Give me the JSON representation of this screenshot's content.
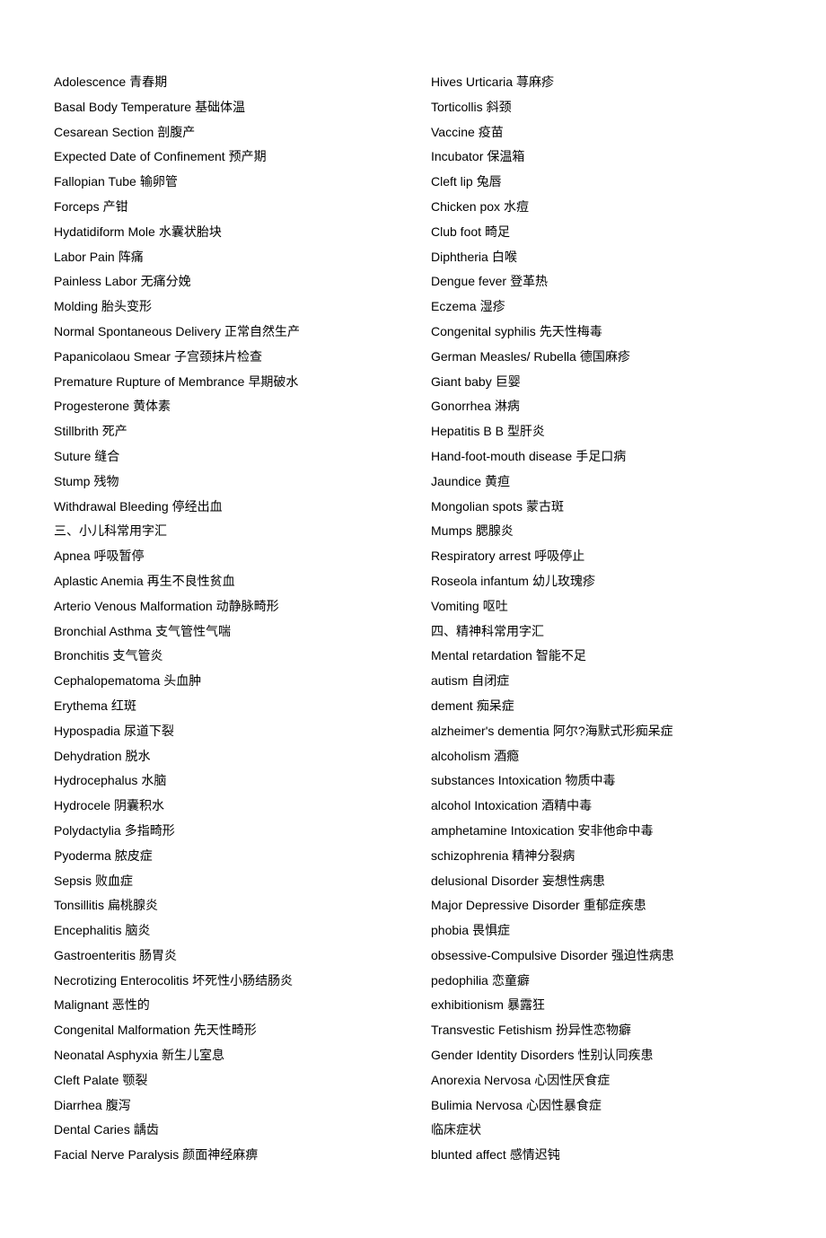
{
  "left_column": [
    {
      "en": "Adolescence",
      "zh": "青春期"
    },
    {
      "en": "Basal Body Temperature",
      "zh": "基础体温"
    },
    {
      "en": "Cesarean Section",
      "zh": "剖腹产"
    },
    {
      "en": "Expected Date of Confinement",
      "zh": "预产期"
    },
    {
      "en": "Fallopian Tube",
      "zh": "输卵管"
    },
    {
      "en": "Forceps",
      "zh": "产钳"
    },
    {
      "en": "Hydatidiform Mole",
      "zh": "水囊状胎块"
    },
    {
      "en": "Labor Pain",
      "zh": "阵痛"
    },
    {
      "en": "Painless Labor",
      "zh": "无痛分娩"
    },
    {
      "en": "Molding",
      "zh": "胎头变形"
    },
    {
      "en": "Normal Spontaneous Delivery",
      "zh": "正常自然生产"
    },
    {
      "en": "Papanicolaou Smear",
      "zh": "子宫颈抹片检查"
    },
    {
      "en": "Premature Rupture of Membrance",
      "zh": "早期破水"
    },
    {
      "en": "Progesterone",
      "zh": "黄体素"
    },
    {
      "en": "Stillbrith",
      "zh": "死产"
    },
    {
      "en": "Suture",
      "zh": "缝合"
    },
    {
      "en": "Stump",
      "zh": "残物"
    },
    {
      "en": "Withdrawal Bleeding",
      "zh": "停经出血"
    },
    {
      "en": "三、小儿科常用字汇",
      "zh": ""
    },
    {
      "en": "Apnea",
      "zh": "呼吸暂停"
    },
    {
      "en": "Aplastic Anemia",
      "zh": "再生不良性贫血"
    },
    {
      "en": "Arterio Venous Malformation",
      "zh": "动静脉畸形"
    },
    {
      "en": "Bronchial Asthma",
      "zh": "支气管性气喘"
    },
    {
      "en": "Bronchitis",
      "zh": "支气管炎"
    },
    {
      "en": "Cephalopematoma",
      "zh": "头血肿"
    },
    {
      "en": "Erythema",
      "zh": "红斑"
    },
    {
      "en": "Hypospadia",
      "zh": "尿道下裂"
    },
    {
      "en": "Dehydration",
      "zh": "脱水"
    },
    {
      "en": "Hydrocephalus",
      "zh": "水脑"
    },
    {
      "en": "Hydrocele",
      "zh": "阴囊积水"
    },
    {
      "en": "Polydactylia",
      "zh": "多指畸形"
    },
    {
      "en": "Pyoderma",
      "zh": "脓皮症"
    },
    {
      "en": "Sepsis",
      "zh": "败血症"
    },
    {
      "en": "Tonsillitis",
      "zh": "扁桃腺炎"
    },
    {
      "en": "Encephalitis",
      "zh": "脑炎"
    },
    {
      "en": "Gastroenteritis",
      "zh": "肠胃炎"
    },
    {
      "en": "Necrotizing Enterocolitis",
      "zh": "坏死性小肠结肠炎"
    },
    {
      "en": "Malignant",
      "zh": "恶性的"
    },
    {
      "en": "Congenital Malformation",
      "zh": "先天性畸形"
    },
    {
      "en": "Neonatal Asphyxia",
      "zh": "新生儿室息"
    },
    {
      "en": "Cleft Palate",
      "zh": "颚裂"
    },
    {
      "en": "Diarrhea",
      "zh": "腹泻"
    },
    {
      "en": "Dental Caries",
      "zh": "龋齿"
    },
    {
      "en": "Facial Nerve Paralysis",
      "zh": "颜面神经麻痹"
    }
  ],
  "right_column": [
    {
      "en": "Hives Urticaria",
      "zh": "荨麻疹"
    },
    {
      "en": "Torticollis",
      "zh": "斜颈"
    },
    {
      "en": "Vaccine",
      "zh": "疫苗"
    },
    {
      "en": "Incubator",
      "zh": "保温箱"
    },
    {
      "en": "Cleft lip",
      "zh": "兔唇"
    },
    {
      "en": "Chicken pox",
      "zh": "水痘"
    },
    {
      "en": "Club foot",
      "zh": "畸足"
    },
    {
      "en": "Diphtheria",
      "zh": "白喉"
    },
    {
      "en": "Dengue fever",
      "zh": "登革热"
    },
    {
      "en": "Eczema",
      "zh": "湿疹"
    },
    {
      "en": "Congenital syphilis",
      "zh": "先天性梅毒"
    },
    {
      "en": "German Measles/ Rubella",
      "zh": "德国麻疹"
    },
    {
      "en": "Giant baby",
      "zh": "巨婴"
    },
    {
      "en": "Gonorrhea",
      "zh": "淋病"
    },
    {
      "en": "Hepatitis B B",
      "zh": "型肝炎"
    },
    {
      "en": "Hand-foot-mouth disease",
      "zh": "手足口病"
    },
    {
      "en": "Jaundice",
      "zh": "黄疸"
    },
    {
      "en": "Mongolian spots",
      "zh": "蒙古斑"
    },
    {
      "en": "Mumps",
      "zh": "腮腺炎"
    },
    {
      "en": "Respiratory arrest",
      "zh": "呼吸停止"
    },
    {
      "en": "Roseola infantum",
      "zh": "幼儿玫瑰疹"
    },
    {
      "en": "Vomiting",
      "zh": "呕吐"
    },
    {
      "en": "四、精神科常用字汇",
      "zh": ""
    },
    {
      "en": "Mental retardation",
      "zh": "智能不足"
    },
    {
      "en": "autism",
      "zh": "自闭症"
    },
    {
      "en": "dement",
      "zh": "痴呆症"
    },
    {
      "en": "alzheimer's dementia",
      "zh": "阿尔?海默式形痴呆症"
    },
    {
      "en": "alcoholism",
      "zh": "酒瘾"
    },
    {
      "en": "substances Intoxication",
      "zh": "物质中毒"
    },
    {
      "en": "alcohol Intoxication",
      "zh": "酒精中毒"
    },
    {
      "en": "amphetamine Intoxication",
      "zh": "安非他命中毒"
    },
    {
      "en": "schizophrenia",
      "zh": "精神分裂病"
    },
    {
      "en": "delusional Disorder",
      "zh": "妄想性病患"
    },
    {
      "en": "Major Depressive Disorder",
      "zh": "重郁症疾患"
    },
    {
      "en": "phobia",
      "zh": "畏惧症"
    },
    {
      "en": "obsessive-Compulsive Disorder",
      "zh": "强迫性病患"
    },
    {
      "en": "pedophilia",
      "zh": "恋童癖"
    },
    {
      "en": "exhibitionism",
      "zh": "暴露狂"
    },
    {
      "en": "Transvestic Fetishism",
      "zh": "扮异性恋物癖"
    },
    {
      "en": "Gender Identity Disorders",
      "zh": "性别认同疾患"
    },
    {
      "en": "Anorexia Nervosa",
      "zh": "心因性厌食症"
    },
    {
      "en": "Bulimia Nervosa",
      "zh": "心因性暴食症"
    },
    {
      "en": "临床症状",
      "zh": ""
    },
    {
      "en": "blunted affect",
      "zh": "感情迟钝"
    }
  ]
}
